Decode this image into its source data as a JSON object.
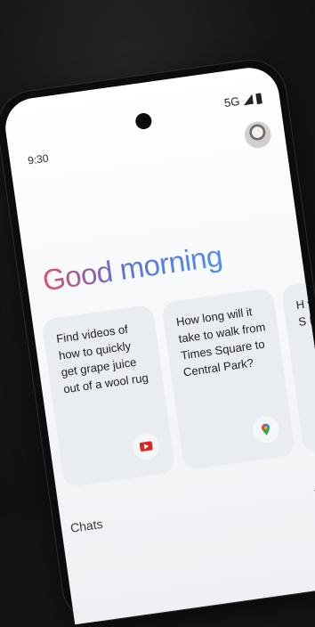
{
  "status_bar": {
    "time": "9:30",
    "network": "5G"
  },
  "greeting": "Good morning",
  "cards": [
    {
      "text": "Find videos of how to quickly get grape juice out of a wool rug",
      "icon": "youtube-icon"
    },
    {
      "text": "How long will it take to walk from Times Square to Central Park?",
      "icon": "google-maps-icon"
    },
    {
      "text": "H w S P",
      "icon": ""
    }
  ],
  "chats": {
    "label": "Chats",
    "icon": "chevron-right-icon"
  },
  "colors": {
    "greeting_start": "#d9566b",
    "greeting_end": "#4f8ef0",
    "card_bg": "#e9ecf0",
    "youtube_red": "#e02424"
  }
}
